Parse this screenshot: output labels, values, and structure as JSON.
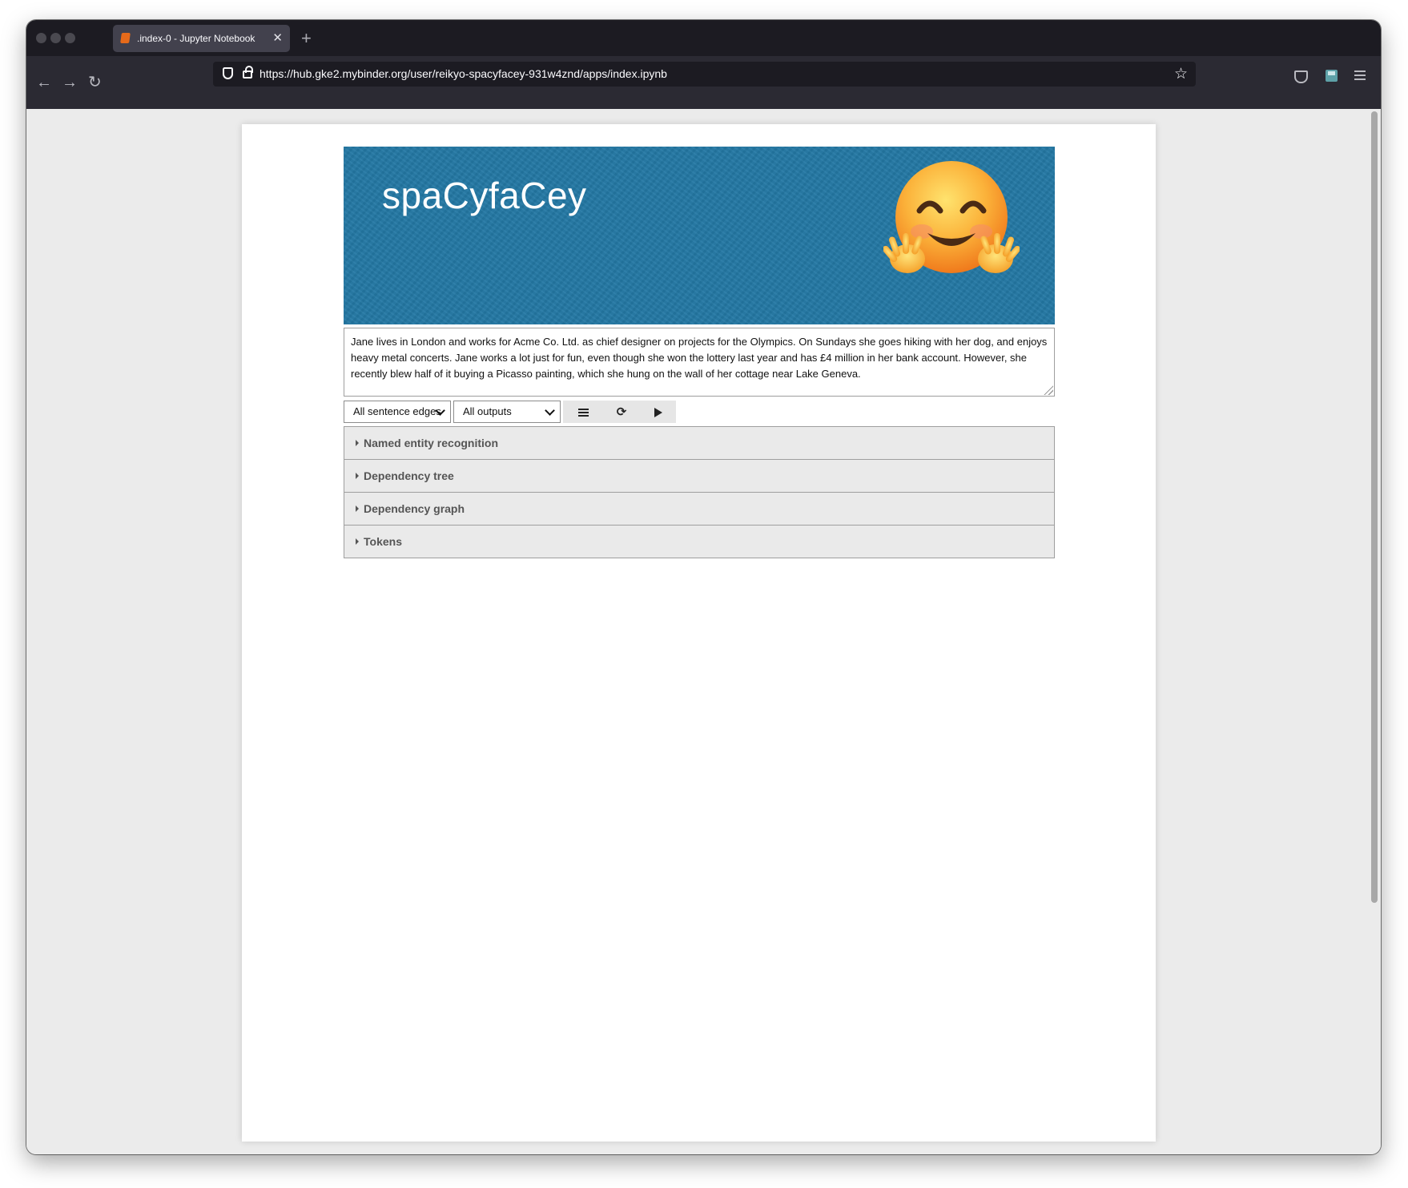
{
  "browser": {
    "tab_title": ".index-0 - Jupyter Notebook",
    "tab_close": "✕",
    "new_tab": "+",
    "url": "https://hub.gke2.mybinder.org/user/reikyo-spacyfacey-931w4znd/apps/index.ipynb",
    "back": "←",
    "forward": "→",
    "reload": "↻",
    "star": "☆"
  },
  "app": {
    "banner_title": "spaCyfaCey",
    "banner_emoji": "hugging-face",
    "input_text": "Jane lives in London and works for Acme Co. Ltd. as chief designer on projects for the Olympics. On Sundays she goes hiking with her dog, and enjoys heavy metal concerts. Jane works a lot just for fun, even though she won the lottery last year and has £4 million in her bank account. However, she recently blew half of it buying a Picasso painting, which she hung on the wall of her cottage near Lake Geneva.",
    "sentence_select": "All sentence edges",
    "output_select": "All outputs",
    "sections": [
      {
        "label": "Named entity recognition"
      },
      {
        "label": "Dependency tree"
      },
      {
        "label": "Dependency graph"
      },
      {
        "label": "Tokens"
      }
    ]
  },
  "colors": {
    "banner": "#2378a4",
    "chrome_dark": "#1c1b22",
    "toolbar": "#2b2a33",
    "accordion_bg": "#eaeaea"
  },
  "icons": {
    "list_button": "list-icon",
    "refresh_button": "refresh-icon",
    "run_button": "play-icon"
  }
}
